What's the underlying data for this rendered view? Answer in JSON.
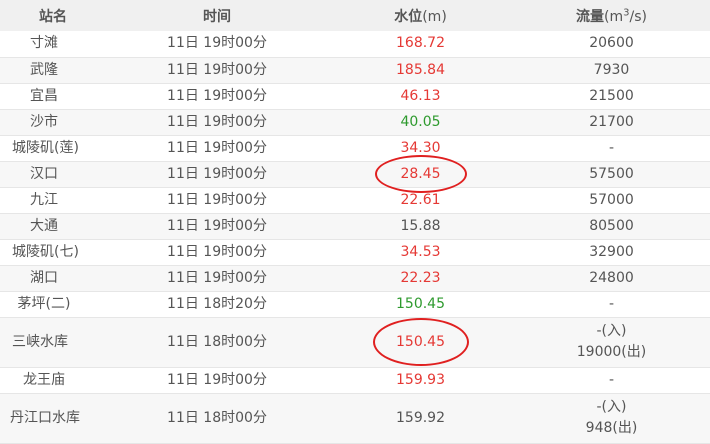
{
  "headers": {
    "station": "站名",
    "time": "时间",
    "level_label": "水位",
    "level_unit": "(m)",
    "flow_label": "流量",
    "flow_unit_pre": "(m",
    "flow_unit_sup": "3",
    "flow_unit_post": "/s)"
  },
  "rows": [
    {
      "station": "寸滩",
      "time": "11日 19时00分",
      "level": "168.72",
      "flow": "20600"
    },
    {
      "station": "武隆",
      "time": "11日 19时00分",
      "level": "185.84",
      "flow": "7930"
    },
    {
      "station": "宜昌",
      "time": "11日 19时00分",
      "level": "46.13",
      "flow": "21500"
    },
    {
      "station": "沙市",
      "time": "11日 19时00分",
      "level": "40.05",
      "flow": "21700"
    },
    {
      "station": "城陵矶(莲)",
      "time": "11日 19时00分",
      "level": "34.30",
      "flow": "-"
    },
    {
      "station": "汉口",
      "time": "11日 19时00分",
      "level": "28.45",
      "flow": "57500"
    },
    {
      "station": "九江",
      "time": "11日 19时00分",
      "level": "22.61",
      "flow": "57000"
    },
    {
      "station": "大通",
      "time": "11日 19时00分",
      "level": "15.88",
      "flow": "80500"
    },
    {
      "station": "城陵矶(七)",
      "time": "11日 19时00分",
      "level": "34.53",
      "flow": "32900"
    },
    {
      "station": "湖口",
      "time": "11日 19时00分",
      "level": "22.23",
      "flow": "24800"
    },
    {
      "station": "茅坪(二)",
      "time": "11日 18时20分",
      "level": "150.45",
      "flow": "-"
    },
    {
      "station": "三峡水库",
      "time": "11日 18时00分",
      "level": "150.45",
      "flow_in": "-(入)",
      "flow_out": "19000(出)"
    },
    {
      "station": "龙王庙",
      "time": "11日 19时00分",
      "level": "159.93",
      "flow": "-"
    },
    {
      "station": "丹江口水库",
      "time": "11日 18时00分",
      "level": "159.92",
      "flow_in": "-(入)",
      "flow_out": "948(出)"
    }
  ],
  "colors": {
    "high": "#e53935",
    "low": "#2e9a2e",
    "normal": "#555555",
    "annotation": "#e02020"
  }
}
